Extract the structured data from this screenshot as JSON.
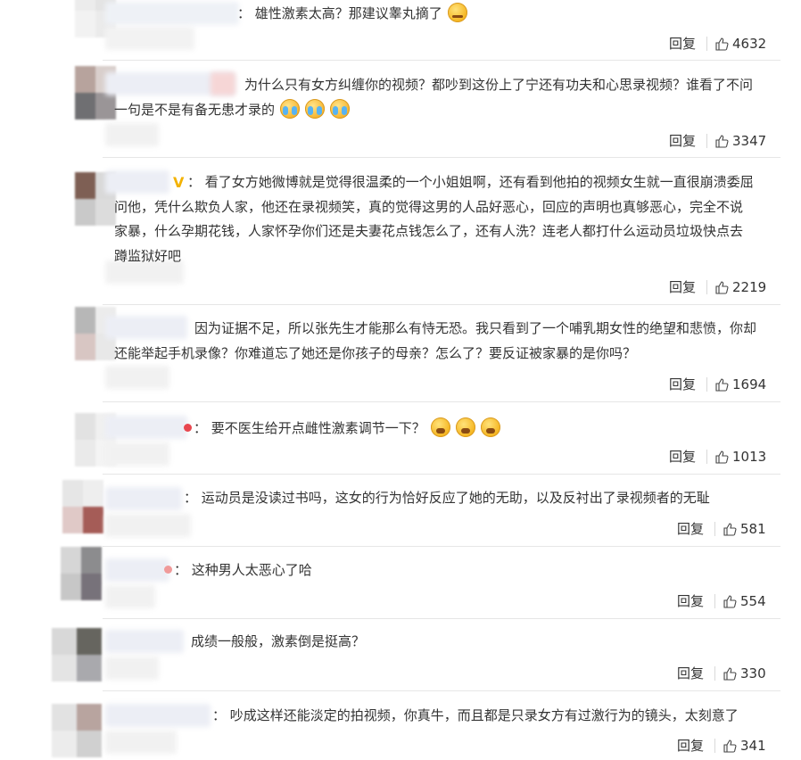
{
  "comments": [
    {
      "text": "：  雄性激素太高？那建议睾丸摘了",
      "emoji": [
        "think"
      ],
      "reply": "回复",
      "likes": "4632"
    },
    {
      "text_lines": [
        "为什么只有女方纠缠你的视频？都吵到这份上了宁还有功夫和心思录视频？谁看了不问",
        "一句是不是有备无患才录的"
      ],
      "emoji": [
        "cry",
        "cry",
        "cry"
      ],
      "reply": "回复",
      "likes": "3347"
    },
    {
      "text_lines": [
        "：  看了女方她微博就是觉得很温柔的一个小姐姐啊，还有看到他拍的视频女生就一直很崩溃委屈",
        "问他，凭什么欺负人家，他还在录视频笑，真的觉得这男的人品好恶心，回应的声明也真够恶心，完全不说",
        "家暴，什么孕期花钱，人家怀孕你们还是夫妻花点钱怎么了，还有人洗？连老人都打什么运动员垃圾快点去",
        "蹲监狱好吧"
      ],
      "badge": "V",
      "reply": "回复",
      "likes": "2219"
    },
    {
      "text_lines": [
        "因为证据不足，所以张先生才能那么有恃无恐。我只看到了一个哺乳期女性的绝望和悲愤，你却",
        "还能举起手机录像？你难道忘了她还是你孩子的母亲？怎么了？要反证被家暴的是你吗？"
      ],
      "reply": "回复",
      "likes": "1694"
    },
    {
      "text": "：  要不医生给开点雌性激素调节一下？",
      "emoji": [
        "gasp",
        "gasp",
        "gasp"
      ],
      "reply": "回复",
      "likes": "1013"
    },
    {
      "text": "：  运动员是没读过书吗，这女的行为恰好反应了她的无助，以及反衬出了录视频者的无耻",
      "reply": "回复",
      "likes": "581"
    },
    {
      "text": "：  这种男人太恶心了哈",
      "reply": "回复",
      "likes": "554"
    },
    {
      "text": "成绩一般般，激素倒是挺高？",
      "reply": "回复",
      "likes": "330"
    },
    {
      "text": "：  吵成这样还能淡定的拍视频，你真牛，而且都是只录女方有过激行为的镜头，太刻意了",
      "reply": "回复",
      "likes": "341"
    }
  ],
  "colors": {
    "text": "#333333",
    "divider": "#e6e6e6",
    "badge": "#f3b200"
  }
}
